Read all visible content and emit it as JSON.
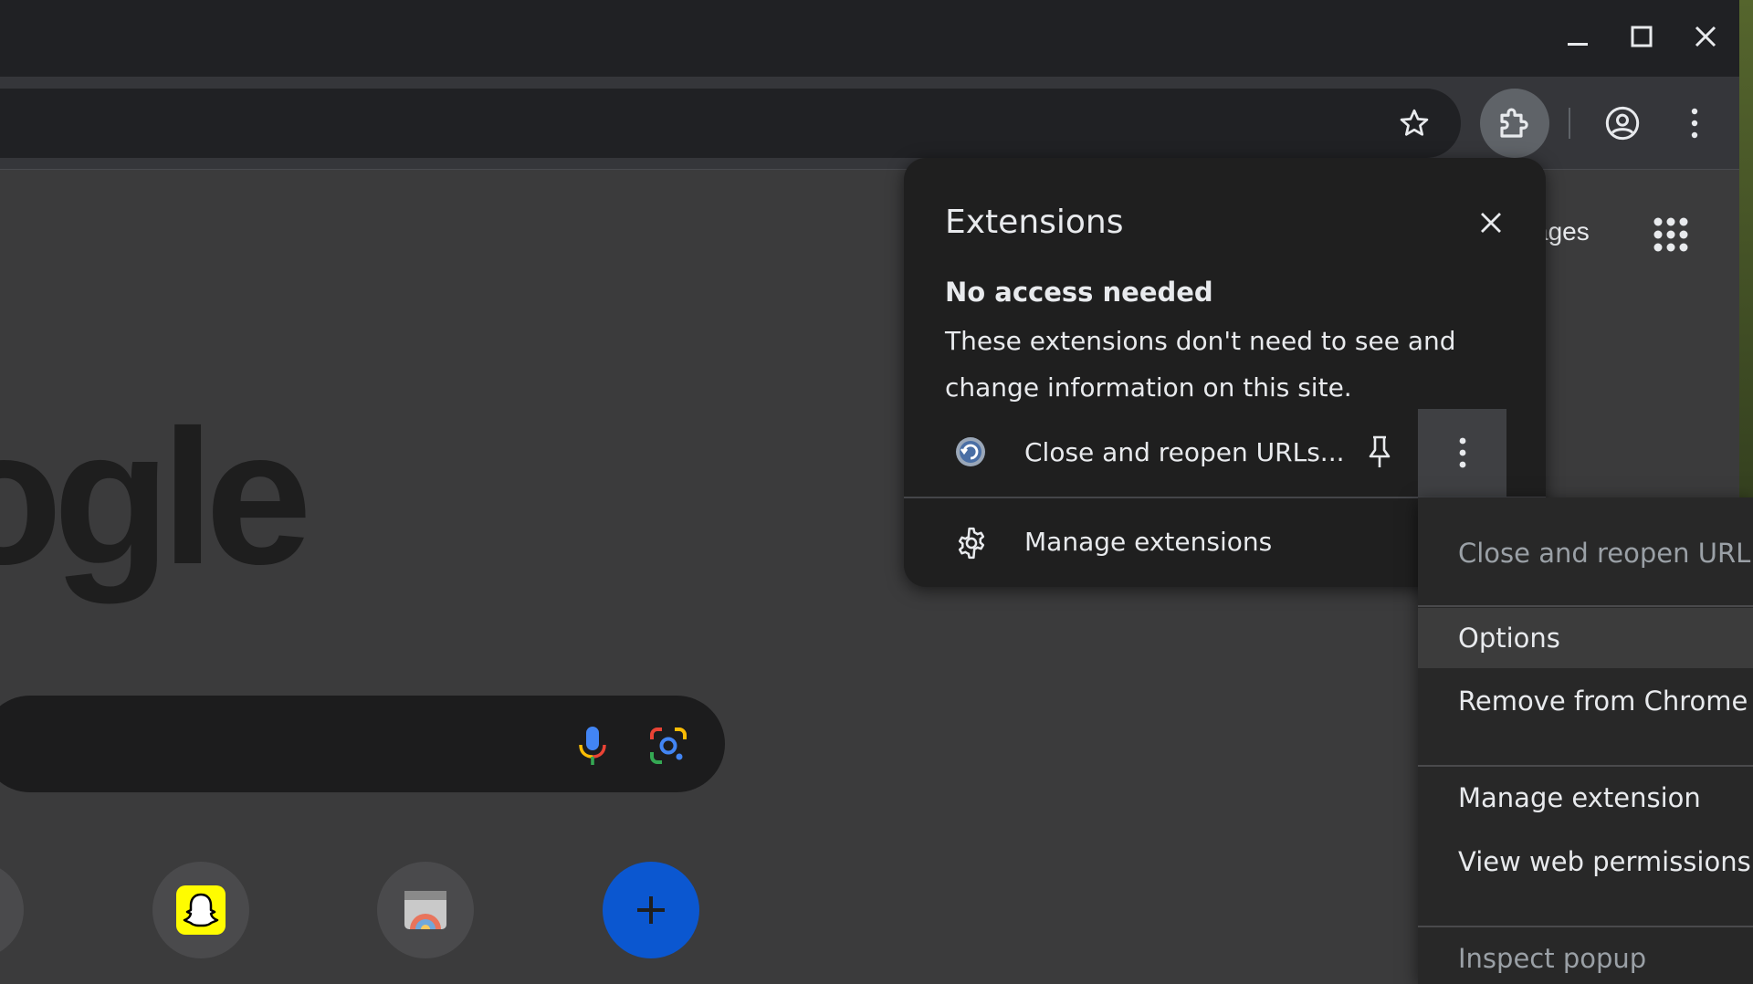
{
  "window": {
    "minimize_icon": "minimize-icon",
    "maximize_icon": "maximize-icon",
    "close_icon": "close-icon"
  },
  "toolbar": {
    "bookmark_icon": "star-icon",
    "extensions_icon": "puzzle-icon",
    "profile_icon": "account-circle-icon",
    "menu_icon": "kebab-menu-icon"
  },
  "page": {
    "logo_fragment": "ogle",
    "images_link": "ages",
    "search": {
      "voice_icon": "microphone-icon",
      "lens_icon": "google-lens-icon"
    },
    "shortcuts": [
      {
        "icon": "snapchat-icon"
      },
      {
        "icon": "app-shortcut-icon"
      },
      {
        "icon": "add-shortcut-icon"
      }
    ]
  },
  "extensions_panel": {
    "title": "Extensions",
    "section_heading": "No access needed",
    "section_description": "These extensions don't need to see and change information on this site.",
    "extension": {
      "name": "Close and reopen URLs...",
      "icon": "refresh-globe-icon"
    },
    "manage_label": "Manage extensions"
  },
  "context_menu": {
    "header": "Close and reopen URL",
    "items": [
      "Options",
      "Remove from Chrome",
      "Manage extension",
      "View web permissions",
      "Inspect popup"
    ]
  },
  "colors": {
    "panel_bg": "#1f1f1f",
    "menu_bg": "#282828",
    "page_bg": "#3b3b3c",
    "accent_blue": "#0b57d0"
  }
}
